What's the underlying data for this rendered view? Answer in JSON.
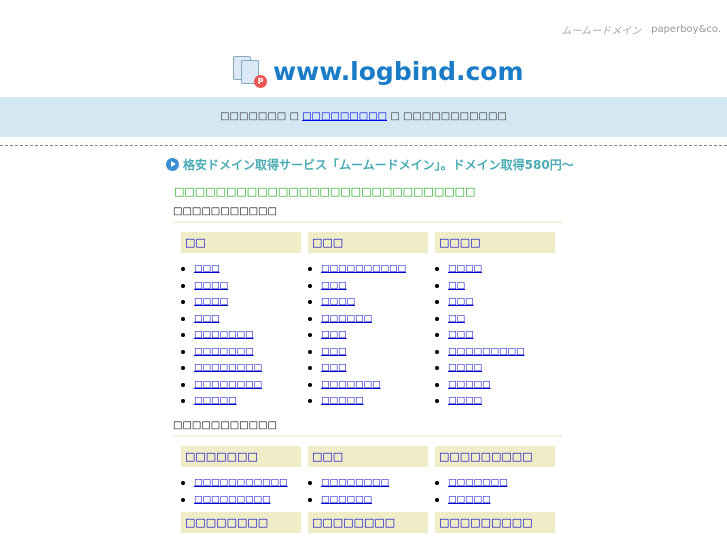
{
  "brand": {
    "muumuu": "ムームードメイン",
    "paperboy": "paperboy&co."
  },
  "site_title": "www.logbind.com",
  "info_bar": {
    "pre": "□□□□□□□",
    "sep1": "□",
    "link": "□□□□□□□□□",
    "sep2": "□",
    "post": "□□□□□□□□□□□"
  },
  "promo": "格安ドメイン取得サービス「ムームードメイン」。ドメイン取得580円～",
  "green_text": "□□□□□□□□□□□□□□□□□□□□□□□□□□□□□",
  "sections": [
    {
      "title": "□□□□□□□□□□□",
      "columns": [
        {
          "header": "□□",
          "items": [
            "□□□",
            "□□□□",
            "□□□□",
            "□□□",
            "□□□□□□□",
            "□□□□□□□",
            "□□□□□□□□",
            "□□□□□□□□",
            "□□□□□"
          ]
        },
        {
          "header": "□□□",
          "items": [
            "□□□□□□□□□□",
            "□□□",
            "□□□□",
            "□□□□□□",
            "□□□",
            "□□□",
            "□□□",
            "□□□□□□□",
            "□□□□□"
          ]
        },
        {
          "header": "□□□□",
          "items": [
            "□□□□",
            "□□",
            "□□□",
            "□□",
            "□□□",
            "□□□□□□□□□",
            "□□□□",
            "□□□□□",
            "□□□□"
          ]
        }
      ]
    },
    {
      "title": "□□□□□□□□□□□",
      "columns": [
        {
          "header": "□□□□□□□",
          "items": [
            "□□□□□□□□□□□",
            "□□□□□□□□□"
          ]
        },
        {
          "header": "□□□",
          "items": [
            "□□□□□□□□",
            "□□□□□□"
          ]
        },
        {
          "header": "□□□□□□□□□",
          "items": [
            "□□□□□□□",
            "□□□□□"
          ]
        }
      ]
    },
    {
      "title": "",
      "columns": [
        {
          "header": "□□□□□□□□",
          "items": []
        },
        {
          "header": "□□□□□□□□",
          "items": []
        },
        {
          "header": "□□□□□□□□□",
          "items": []
        }
      ]
    }
  ]
}
